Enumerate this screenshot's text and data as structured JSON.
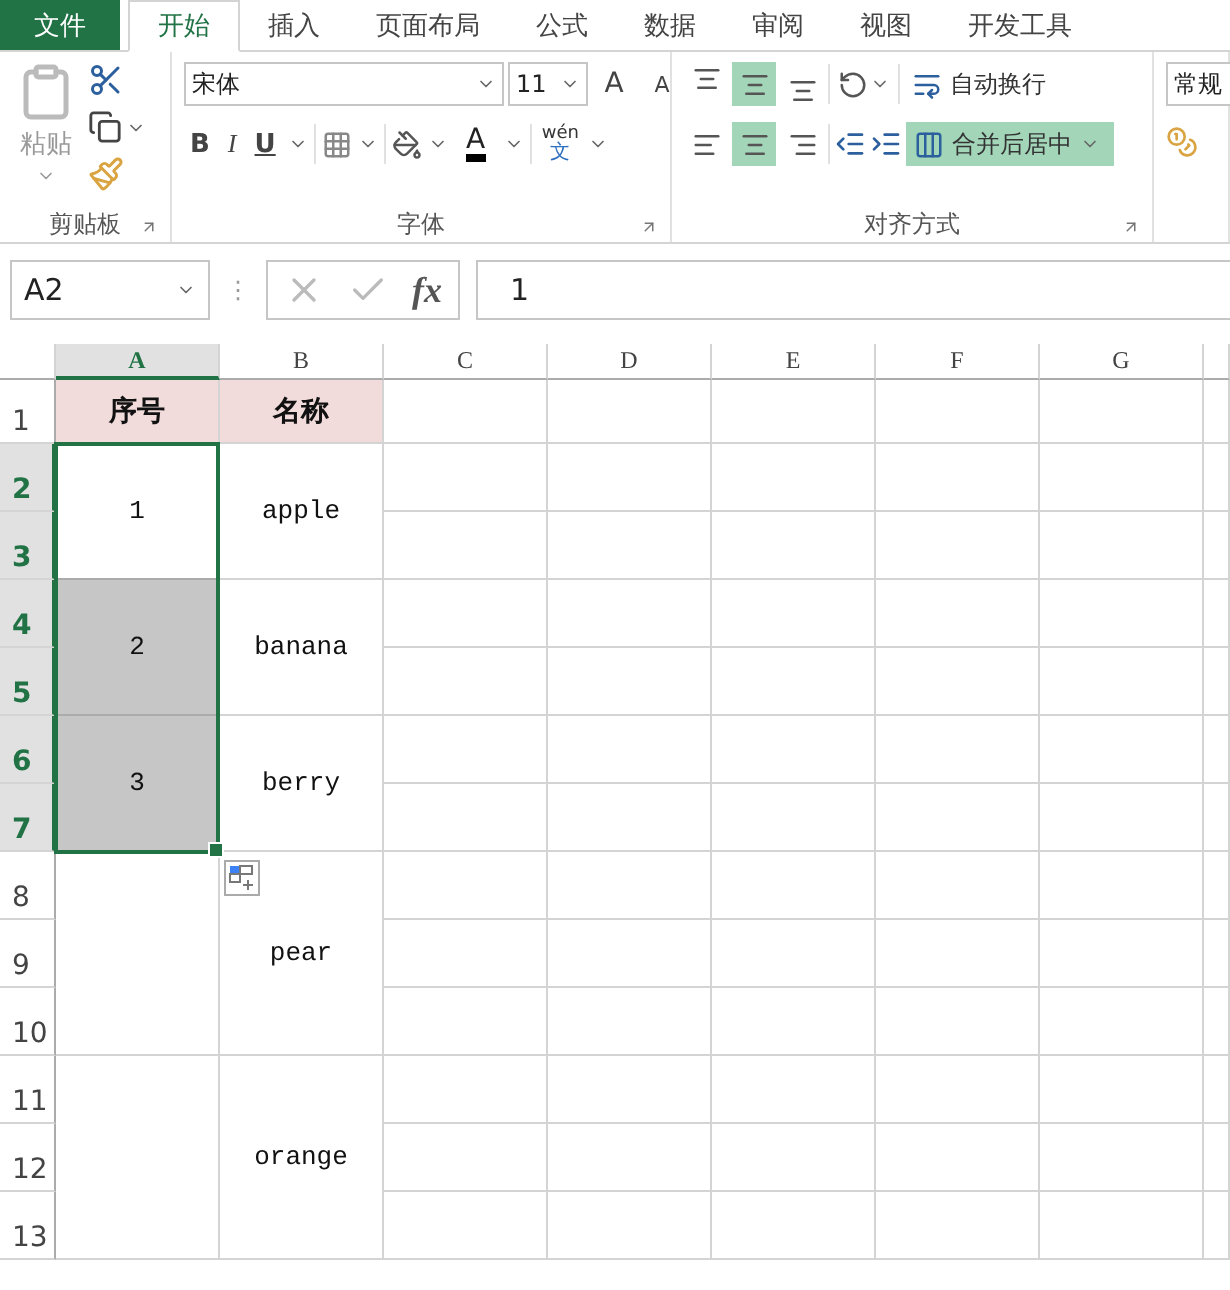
{
  "tabs": [
    {
      "label": "文件",
      "kind": "file",
      "selected": false
    },
    {
      "label": "开始",
      "kind": "tab",
      "selected": true
    },
    {
      "label": "插入",
      "kind": "tab",
      "selected": false
    },
    {
      "label": "页面布局",
      "kind": "tab",
      "selected": false
    },
    {
      "label": "公式",
      "kind": "tab",
      "selected": false
    },
    {
      "label": "数据",
      "kind": "tab",
      "selected": false
    },
    {
      "label": "审阅",
      "kind": "tab",
      "selected": false
    },
    {
      "label": "视图",
      "kind": "tab",
      "selected": false
    },
    {
      "label": "开发工具",
      "kind": "tab",
      "selected": false
    }
  ],
  "ribbon": {
    "clipboard": {
      "label": "剪贴板",
      "paste": "粘贴"
    },
    "font": {
      "label": "字体",
      "font_name": "宋体",
      "font_size": "11",
      "grow": "A",
      "shrink": "A",
      "styles": [
        "B",
        "I",
        "U"
      ],
      "font_color": "A",
      "phonetic_top": "wén",
      "phonetic_bottom": "文"
    },
    "alignment": {
      "label": "对齐方式",
      "vertical": [
        {
          "selected": false
        },
        {
          "selected": true
        },
        {
          "selected": false
        }
      ],
      "horizontal": [
        {
          "selected": false
        },
        {
          "selected": true
        },
        {
          "selected": false
        }
      ],
      "wrap": "自动换行",
      "merge": {
        "label": "合并后居中",
        "selected": true
      }
    },
    "number": {
      "format": "常规"
    }
  },
  "formula_bar": {
    "name_box": "A2",
    "more": "⋮",
    "fx": "fx",
    "value": "1"
  },
  "sheet": {
    "columns": [
      {
        "label": "A",
        "selected": true
      },
      {
        "label": "B",
        "selected": false
      },
      {
        "label": "C",
        "selected": false
      },
      {
        "label": "D",
        "selected": false
      },
      {
        "label": "E",
        "selected": false
      },
      {
        "label": "F",
        "selected": false
      },
      {
        "label": "G",
        "selected": false
      }
    ],
    "row_groups": [
      {
        "rows": [
          {
            "label": "1",
            "selected": false
          }
        ],
        "cells": [
          {
            "kind": "header",
            "text": "序号",
            "selected": false
          },
          {
            "kind": "header",
            "text": "名称",
            "selected": false
          }
        ]
      },
      {
        "rows": [
          {
            "label": "2",
            "selected": true
          },
          {
            "label": "3",
            "selected": true
          }
        ],
        "cells": [
          {
            "kind": "data",
            "text": "1",
            "selected": true,
            "active": true
          },
          {
            "kind": "data",
            "text": "apple",
            "selected": false
          }
        ]
      },
      {
        "rows": [
          {
            "label": "4",
            "selected": true
          },
          {
            "label": "5",
            "selected": true
          }
        ],
        "cells": [
          {
            "kind": "data",
            "text": "2",
            "selected": true,
            "active": false
          },
          {
            "kind": "data",
            "text": "banana",
            "selected": false
          }
        ]
      },
      {
        "rows": [
          {
            "label": "6",
            "selected": true
          },
          {
            "label": "7",
            "selected": true
          }
        ],
        "cells": [
          {
            "kind": "data",
            "text": "3",
            "selected": true,
            "active": false
          },
          {
            "kind": "data",
            "text": "berry",
            "selected": false
          }
        ]
      },
      {
        "rows": [
          {
            "label": "8",
            "selected": false
          },
          {
            "label": "9",
            "selected": false
          },
          {
            "label": "10",
            "selected": false
          }
        ],
        "cells": [
          {
            "kind": "data",
            "selected": false
          },
          {
            "kind": "data",
            "text": "pear",
            "selected": false
          }
        ]
      },
      {
        "rows": [
          {
            "label": "11",
            "selected": false
          },
          {
            "label": "12",
            "selected": false
          },
          {
            "label": "13",
            "selected": false
          }
        ],
        "cells": [
          {
            "kind": "data",
            "selected": false
          },
          {
            "kind": "data",
            "text": "orange",
            "selected": false
          }
        ]
      }
    ]
  }
}
